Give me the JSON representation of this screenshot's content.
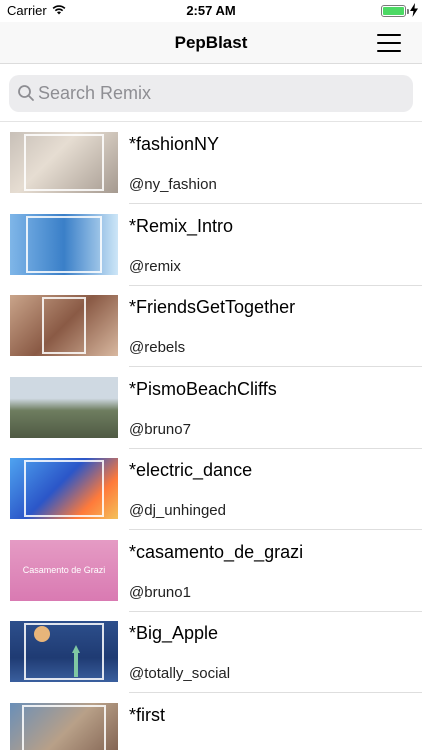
{
  "status_bar": {
    "carrier": "Carrier",
    "time": "2:57 AM",
    "battery_level": 1.0
  },
  "nav": {
    "title": "PepBlast",
    "menu_icon": "hamburger-menu-icon"
  },
  "search": {
    "placeholder": "Search Remix",
    "value": ""
  },
  "remixes": [
    {
      "title": "*fashionNY",
      "user": "@ny_fashion",
      "thumb_caption": ""
    },
    {
      "title": "*Remix_Intro",
      "user": "@remix",
      "thumb_caption": ""
    },
    {
      "title": "*FriendsGetTogether",
      "user": "@rebels",
      "thumb_caption": ""
    },
    {
      "title": "*PismoBeachCliffs",
      "user": "@bruno7",
      "thumb_caption": ""
    },
    {
      "title": "*electric_dance",
      "user": "@dj_unhinged",
      "thumb_caption": ""
    },
    {
      "title": "*casamento_de_grazi",
      "user": "@bruno1",
      "thumb_caption": "Casamento de Grazi"
    },
    {
      "title": "*Big_Apple",
      "user": "@totally_social",
      "thumb_caption": ""
    },
    {
      "title": "*first",
      "user": "",
      "thumb_caption": ""
    }
  ],
  "colors": {
    "battery": "#4cd964",
    "search_field": "#ececee",
    "placeholder": "#8e8e93"
  }
}
